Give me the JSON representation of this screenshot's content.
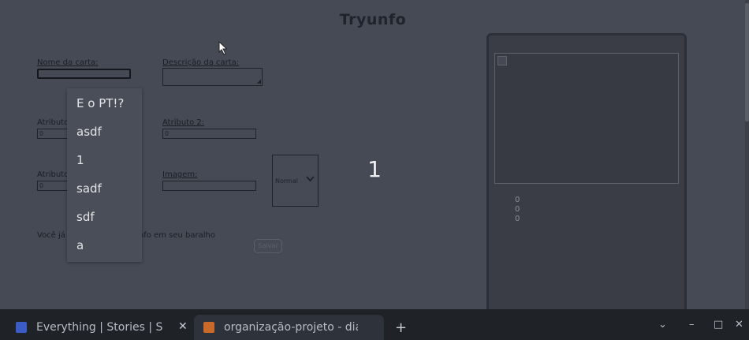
{
  "app": {
    "title": "Tryunfo"
  },
  "form": {
    "name_label": "Nome da carta:",
    "name_value": "",
    "description_label": "Descrição da carta:",
    "attr1_label": "Atributo 1:",
    "attr1_value": "0",
    "attr2_label": "Atributo 2:",
    "attr2_value": "0",
    "attr3_label": "Atributo 3:",
    "attr3_value": "0",
    "image_label": "Imagem:",
    "rarity_selected": "Normal",
    "trunfo_text": "Você já tem um Super Trunfo em seu baralho",
    "save_label": "Salvar"
  },
  "counter": "1",
  "autocomplete": {
    "items": [
      "E o PT!?",
      "asdf",
      "1",
      "sadf",
      "sdf",
      "a"
    ]
  },
  "preview": {
    "attr1": "0",
    "attr2": "0",
    "attr3": "0"
  },
  "browser": {
    "tabs": [
      {
        "title": "Everything | Stories | Sho",
        "favicon_color": "#3b5cc4"
      },
      {
        "title": "organização-projeto - dia",
        "favicon_color": "#c9692a"
      }
    ],
    "new_tab": "+",
    "controls": {
      "chevron": "⌄",
      "minimize": "–",
      "maximize": "□",
      "close": "✕"
    }
  }
}
